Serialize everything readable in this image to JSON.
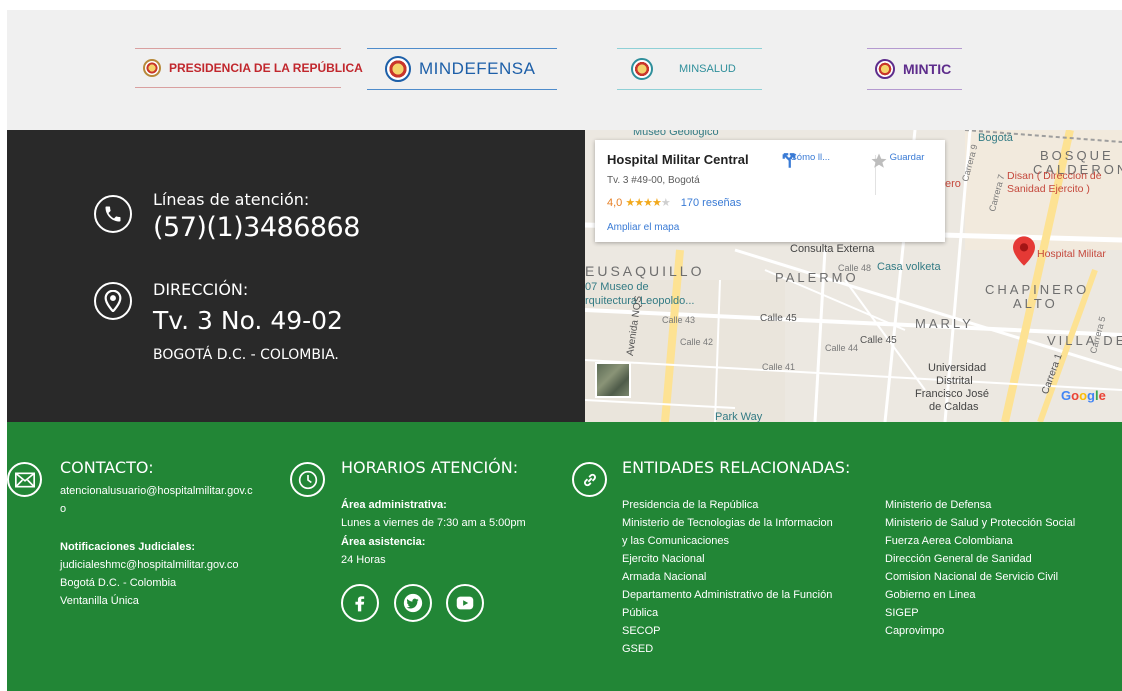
{
  "logos": {
    "presidencia": "PRESIDENCIA DE LA REPÚBLICA",
    "mindefensa": "MINDEFENSA",
    "minsalud": "MINSALUD",
    "mintic": "MINTIC"
  },
  "contact": {
    "lines_label": "Líneas de atención:",
    "phone": "(57)(1)3486868",
    "address_label": "DIRECCIÓN:",
    "address": "Tv. 3 No. 49-02",
    "city": "BOGOTÁ D.C. - COLOMBIA."
  },
  "map": {
    "place_name": "Hospital Militar Central",
    "place_address": "Tv. 3 #49-00, Bogotá",
    "rating": "4,0",
    "stars": "★★★★",
    "stars_off": "★",
    "reviews": "170 reseñas",
    "enlarge_link": "Ampliar el mapa",
    "directions_label": "Cómo ll...",
    "save_label": "Guardar",
    "labels": {
      "museo_geologico": "Museo Geologico",
      "bogota": "Bogotá",
      "bosque": "BOSQUE",
      "calderon": "CALDERON",
      "disan": "Disan ( Direccion de",
      "sanidad": "Sanidad Ejercito )",
      "hospital_militar": "Hospital Militar",
      "consulta_externa": "Consulta Externa",
      "casa_volketa": "Casa volketa",
      "teusaquillo": "EUSAQUILLO",
      "palermo": "PALERMO",
      "chapinero": "CHAPINERO",
      "alto": "ALTO",
      "marly": "MARLY",
      "villa_de": "VILLA DE",
      "museo_arq_1": "07 Museo de",
      "museo_arq_2": "rquitectura Leopoldo...",
      "calle45": "Calle 45",
      "calle45b": "Calle 45",
      "calle43": "Calle 43",
      "calle42": "Calle 42",
      "calle44": "Calle 44",
      "calle41": "Calle 41",
      "calle48": "Calle 48",
      "avenida_nqs": "Avenida NQS",
      "universidad_1": "Universidad",
      "universidad_2": "Distrital",
      "universidad_3": "Francisco José",
      "universidad_4": "de Caldas",
      "park_way": "Park Way",
      "carrera7": "Carrera 7",
      "carrera5": "Carrera 5",
      "carrera1": "Carrera 1",
      "carrera9": "Carrera 9",
      "ero": "ero",
      "google": [
        "G",
        "o",
        "o",
        "g",
        "l",
        "e"
      ]
    }
  },
  "footer": {
    "contact": {
      "title": "CONTACTO:",
      "email_1": "atencionalusuario@hospitalmilitar.gov.c",
      "email_2": "o",
      "notif_label": "Notificaciones Judiciales:",
      "notif_email": "judicialeshmc@hospitalmilitar.gov.co",
      "city": "Bogotá D.C. - Colombia",
      "ventanilla": "Ventanilla Única"
    },
    "hours": {
      "title": "HORARIOS ATENCIÓN:",
      "admin_label": "Área administrativa:",
      "admin_hours": "Lunes a viernes de 7:30 am a 5:00pm",
      "assist_label": "Área asistencia:",
      "assist_hours": "24 Horas"
    },
    "entities": {
      "title": "ENTIDADES RELACIONADAS:",
      "col1": [
        "Presidencia de la República",
        "Ministerio de Tecnologias de la Informacion",
        "y las Comunicaciones",
        "Ejercito Nacional",
        "Armada Nacional",
        "Departamento Administrativo de la Función",
        "Pública",
        "SECOP",
        "GSED"
      ],
      "col2": [
        "Ministerio de Defensa",
        "Ministerio de Salud y Protección Social",
        "Fuerza Aerea Colombiana",
        "Dirección General de Sanidad",
        "Comision Nacional de Servicio Civil",
        "Gobierno en Linea",
        "SIGEP",
        "Caprovimpo"
      ]
    }
  },
  "icons": [
    "phone-icon",
    "location-pin-icon",
    "email-icon",
    "clock-icon",
    "link-icon",
    "facebook-icon",
    "twitter-icon",
    "youtube-icon",
    "directions-icon",
    "star-icon",
    "map-pin-icon"
  ]
}
